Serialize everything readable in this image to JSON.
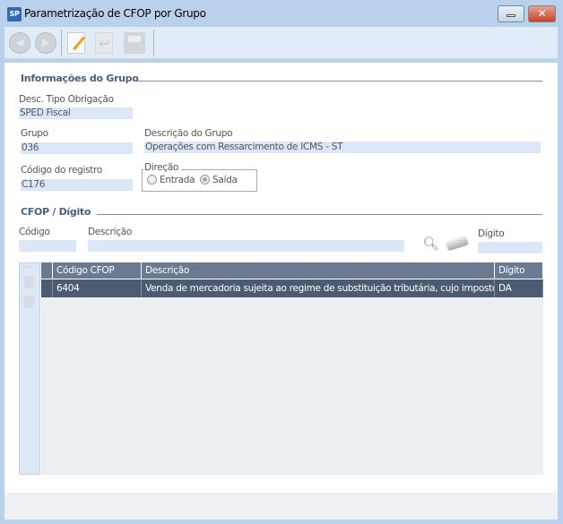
{
  "window": {
    "title": "Parametrização de CFOP por Grupo",
    "app_icon": "SP"
  },
  "toolbar": {
    "buttons": [
      "back-icon",
      "forward-icon",
      "edit-icon",
      "undo-icon",
      "save-icon"
    ]
  },
  "info": {
    "section_title": "Informações do Grupo",
    "tipo_label": "Desc. Tipo Obrigação",
    "tipo_value": "SPED Fiscal",
    "grupo_label": "Grupo",
    "grupo_value": "036",
    "desc_grupo_label": "Descrição do Grupo",
    "desc_grupo_value": "Operações com Ressarcimento de ICMS - ST",
    "registro_label": "Código do registro",
    "registro_value": "C176",
    "direcao_label": "Direção",
    "entrada_label": "Entrada",
    "saida_label": "Saída",
    "direcao_selected": "Saída"
  },
  "cfop": {
    "section_title": "CFOP / Dígito",
    "codigo_label": "Código",
    "codigo_value": "",
    "descricao_label": "Descrição",
    "descricao_value": "",
    "digito_label": "Dígito",
    "digito_value": ""
  },
  "grid": {
    "columns": [
      "Código CFOP",
      "Descrição",
      "Dígito"
    ],
    "rows": [
      {
        "codigo": "6404",
        "descricao": "Venda de mercadoria sujeita ao regime de substituição tributária, cujo imposto já ...",
        "digito": "DA"
      }
    ]
  }
}
